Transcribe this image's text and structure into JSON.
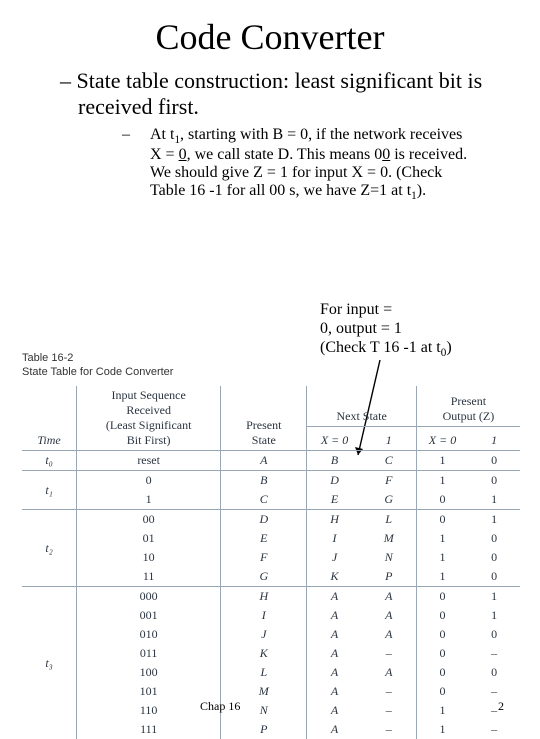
{
  "title": "Code Converter",
  "bullet1": "– State table construction: least significant bit is received first.",
  "bullet2_pre": "At t",
  "bullet2_t": "1",
  "bullet2_mid1": ",  starting with B = 0, if the network receives X = ",
  "bullet2_zero_u": "0",
  "bullet2_mid2": ", we call state D. This means 0",
  "bullet2_zero_u2": "0",
  "bullet2_mid3": " is received. We should give Z = 1 for input X = 0. (Check Table 16 -1 for all 00 s, we have Z=1 at t",
  "bullet2_t2": "1",
  "bullet2_end": ").",
  "annot_l1": "For input =",
  "annot_l2": "0, output = 1",
  "annot_l3_pre": "(Check T 16 -1 at t",
  "annot_l3_sub": "0",
  "annot_l3_post": ")",
  "table_label": "Table 16-2",
  "table_title": "State Table for Code Converter",
  "headers": {
    "time": "Time",
    "seq_l1": "Input Sequence",
    "seq_l2": "Received",
    "seq_l3": "(Least Significant",
    "seq_l4": "Bit First)",
    "ps_l1": "Present",
    "ps_l2": "State",
    "ns_l1": "Next State",
    "ns_x0": "X = 0",
    "ns_x1": "1",
    "out_l1": "Present",
    "out_l2": "Output (Z)",
    "out_x0": "X = 0",
    "out_x1": "1"
  },
  "groups": [
    {
      "time": "t₀",
      "rows": [
        {
          "seq": "reset",
          "ps": "A",
          "n0": "B",
          "n1": "C",
          "z0": "1",
          "z1": "0"
        }
      ]
    },
    {
      "time": "t₁",
      "rows": [
        {
          "seq": "0",
          "ps": "B",
          "n0": "D",
          "n1": "F",
          "z0": "1",
          "z1": "0"
        },
        {
          "seq": "1",
          "ps": "C",
          "n0": "E",
          "n1": "G",
          "z0": "0",
          "z1": "1"
        }
      ]
    },
    {
      "time": "t₂",
      "rows": [
        {
          "seq": "00",
          "ps": "D",
          "n0": "H",
          "n1": "L",
          "z0": "0",
          "z1": "1"
        },
        {
          "seq": "01",
          "ps": "E",
          "n0": "I",
          "n1": "M",
          "z0": "1",
          "z1": "0"
        },
        {
          "seq": "10",
          "ps": "F",
          "n0": "J",
          "n1": "N",
          "z0": "1",
          "z1": "0"
        },
        {
          "seq": "11",
          "ps": "G",
          "n0": "K",
          "n1": "P",
          "z0": "1",
          "z1": "0"
        }
      ]
    },
    {
      "time": "t₃",
      "rows": [
        {
          "seq": "000",
          "ps": "H",
          "n0": "A",
          "n1": "A",
          "z0": "0",
          "z1": "1"
        },
        {
          "seq": "001",
          "ps": "I",
          "n0": "A",
          "n1": "A",
          "z0": "0",
          "z1": "1"
        },
        {
          "seq": "010",
          "ps": "J",
          "n0": "A",
          "n1": "A",
          "z0": "0",
          "z1": "0"
        },
        {
          "seq": "011",
          "ps": "K",
          "n0": "A",
          "n1": "–",
          "z0": "0",
          "z1": "–"
        },
        {
          "seq": "100",
          "ps": "L",
          "n0": "A",
          "n1": "A",
          "z0": "0",
          "z1": "0"
        },
        {
          "seq": "101",
          "ps": "M",
          "n0": "A",
          "n1": "–",
          "z0": "0",
          "z1": "–"
        },
        {
          "seq": "110",
          "ps": "N",
          "n0": "A",
          "n1": "–",
          "z0": "1",
          "z1": "–"
        },
        {
          "seq": "111",
          "ps": "P",
          "n0": "A",
          "n1": "–",
          "z0": "1",
          "z1": "–"
        }
      ]
    }
  ],
  "footer_left": "Chap 16",
  "footer_right": "2"
}
